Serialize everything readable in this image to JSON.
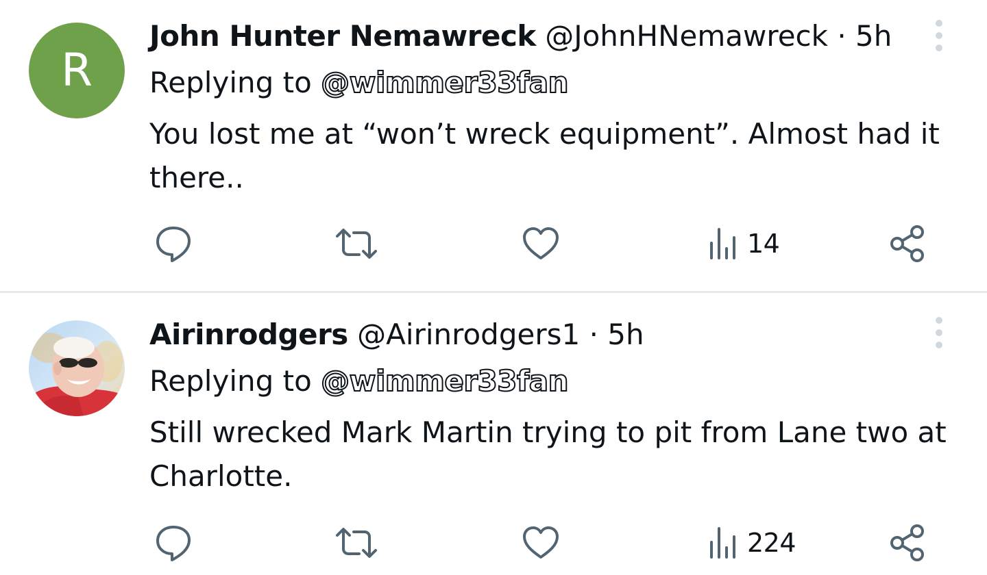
{
  "tweets": [
    {
      "avatar": {
        "type": "letter",
        "letter": "R",
        "bg_color": "#6fa04a"
      },
      "display_name": "John Hunter Nemawreck",
      "handle": "@JohnHNemawreck",
      "separator": "·",
      "time": "5h",
      "replying_label": "Replying to ",
      "replying_to": "@wimmer33fan",
      "text": "You lost me at “won’t wreck equipment”. Almost had it there..",
      "views": "14"
    },
    {
      "avatar": {
        "type": "photo",
        "description_icon": "profile-photo"
      },
      "display_name": "Airinrodgers",
      "handle": "@Airinrodgers1",
      "separator": "·",
      "time": "5h",
      "replying_label": "Replying to ",
      "replying_to": "@wimmer33fan",
      "text": "Still wrecked Mark Martin trying to pit from Lane two at Charlotte.",
      "views": "224"
    }
  ],
  "icons": {
    "reply": "reply-bubble-icon",
    "retweet": "retweet-icon",
    "like": "heart-icon",
    "views": "views-bar-chart-icon",
    "share": "share-icon",
    "more": "more-vertical-icon"
  },
  "colors": {
    "text": "#0f1419",
    "icon": "#536471",
    "divider": "#e6e8ea",
    "more_dots": "#cfd9de"
  }
}
